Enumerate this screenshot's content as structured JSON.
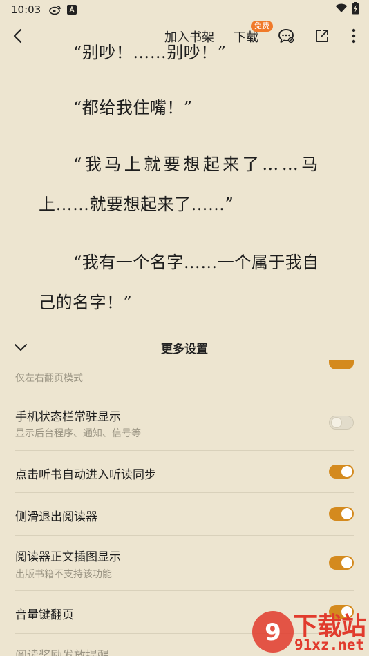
{
  "status_bar": {
    "time": "10:03",
    "icons": [
      "weibo-icon",
      "a-app-icon",
      "wifi-icon",
      "battery-icon"
    ]
  },
  "top_bar": {
    "add_shelf": "加入书架",
    "download": "下载",
    "free_badge": "免费"
  },
  "content": {
    "p0": "“别吵！……别吵！”",
    "p1": "“都给我住嘴！”",
    "p2a": "“我马上就要想起来了……马",
    "p2b": "上……就要想起来了……”",
    "p3a": "“我有一个名字……一个属于我自",
    "p3b": "己的名字！”"
  },
  "panel": {
    "title": "更多设置",
    "settings": [
      {
        "title": "",
        "subtitle": "仅左右翻页模式",
        "on": true
      },
      {
        "title": "手机状态栏常驻显示",
        "subtitle": "显示后台程序、通知、信号等",
        "on": false
      },
      {
        "title": "点击听书自动进入听读同步",
        "subtitle": "",
        "on": true
      },
      {
        "title": "侧滑退出阅读器",
        "subtitle": "",
        "on": true
      },
      {
        "title": "阅读器正文插图显示",
        "subtitle": "出版书籍不支持该功能",
        "on": true
      },
      {
        "title": "音量键翻页",
        "subtitle": "",
        "on": true
      },
      {
        "title": "阅读奖励发放提醒",
        "subtitle": "",
        "on": null
      }
    ]
  },
  "watermark": {
    "text": "下载站",
    "url": "91xz.net"
  },
  "colors": {
    "accent": "#d48a1e",
    "background": "#ede5d0",
    "badge": "#f07a2a"
  }
}
